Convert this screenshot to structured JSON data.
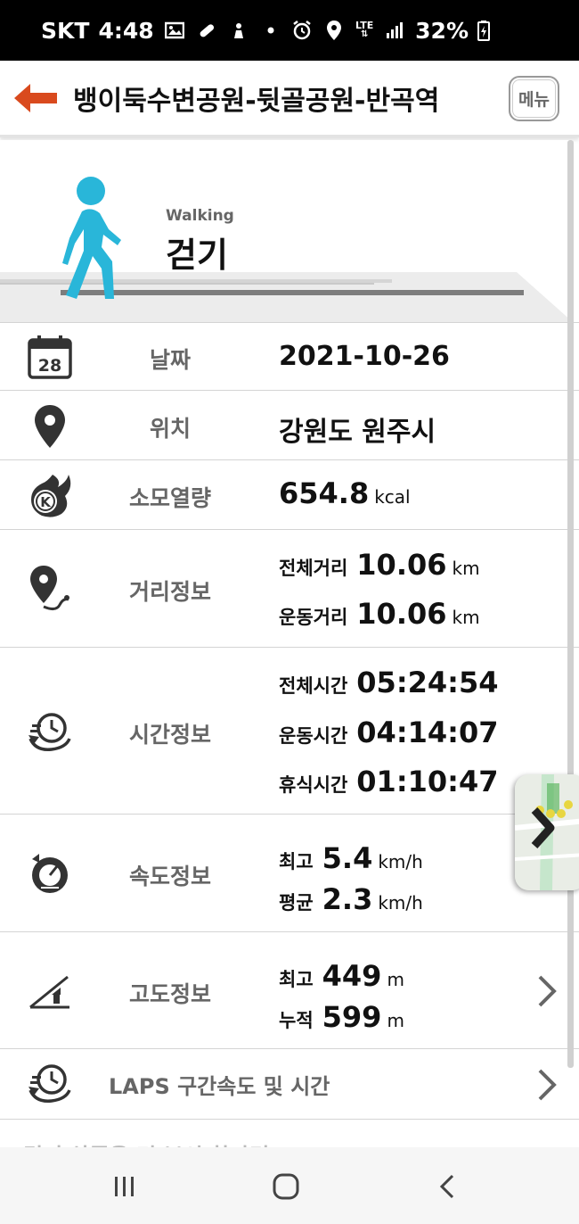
{
  "status_bar": {
    "carrier": "SKT",
    "time": "4:48",
    "network": "LTE",
    "battery": "32%"
  },
  "header": {
    "title": "뱅이둑수변공원-뒷골공원-반곡역",
    "menu_label": "메뉴"
  },
  "activity": {
    "subtitle": "Walking",
    "title": "걷기"
  },
  "rows": {
    "date": {
      "label": "날짜",
      "value": "2021-10-26",
      "icon_day": "28"
    },
    "location": {
      "label": "위치",
      "value": "강원도 원주시"
    },
    "calories": {
      "label": "소모열량",
      "value": "654.8",
      "unit": "kcal",
      "icon_letter": "K"
    },
    "distance": {
      "label": "거리정보",
      "total_label": "전체거리",
      "total_value": "10.06",
      "total_unit": "km",
      "exercise_label": "운동거리",
      "exercise_value": "10.06",
      "exercise_unit": "km"
    },
    "time": {
      "label": "시간정보",
      "total_label": "전체시간",
      "total_value": "05:24:54",
      "exercise_label": "운동시간",
      "exercise_value": "04:14:07",
      "rest_label": "휴식시간",
      "rest_value": "01:10:47"
    },
    "speed": {
      "label": "속도정보",
      "max_label": "최고",
      "max_value": "5.4",
      "max_unit": "km/h",
      "avg_label": "평균",
      "avg_value": "2.3",
      "avg_unit": "km/h"
    },
    "altitude": {
      "label": "고도정보",
      "max_label": "최고",
      "max_value": "449",
      "max_unit": "m",
      "cum_label": "누적",
      "cum_value": "599",
      "cum_unit": "m"
    },
    "laps": {
      "label": "LAPS 구간속도 및 시간"
    }
  },
  "partial_row_text": "걷기 상품을 더 보시 한다면",
  "icons": {
    "back": "arrow-left-icon",
    "walker": "walking-person-icon",
    "calendar": "calendar-icon",
    "location": "location-pin-icon",
    "calorie": "calorie-flame-icon",
    "distance": "route-pin-icon",
    "time": "clock-icon",
    "speed": "speedometer-icon",
    "altitude": "altitude-icon",
    "chevron": "chevron-right-icon"
  },
  "colors": {
    "accent": "#d94a1e",
    "walker": "#29b6d9",
    "label_gray": "#666666"
  }
}
